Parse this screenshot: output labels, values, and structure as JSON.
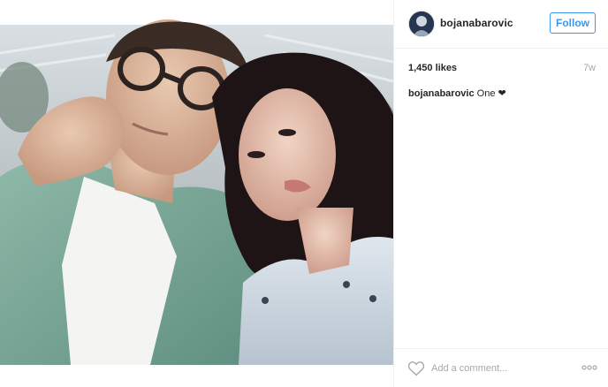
{
  "post": {
    "username": "bojanabarovic",
    "follow_label": "Follow",
    "likes": "1,450 likes",
    "time_ago": "7w",
    "caption": {
      "username": "bojanabarovic",
      "text": "One",
      "emoji": "❤"
    },
    "comment_placeholder": "Add a comment...",
    "like_icon": "heart-outline-icon",
    "more_icon": "more-options-icon"
  },
  "colors": {
    "accent": "#3897f0",
    "text": "#262626",
    "muted": "#a5a7aa",
    "divider": "#efefef"
  }
}
